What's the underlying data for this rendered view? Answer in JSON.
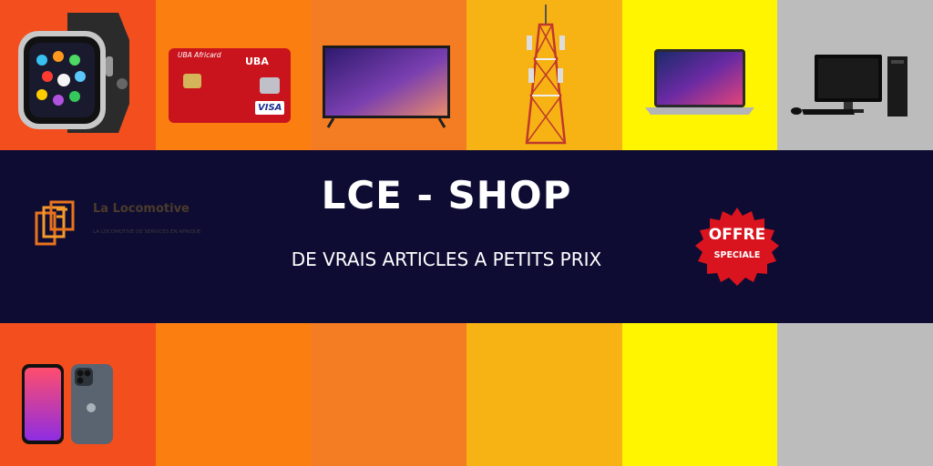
{
  "banner": {
    "title": "LCE - SHOP",
    "subtitle": "DE VRAIS ARTICLES A PETITS PRIX"
  },
  "logo": {
    "name": "La Locomotive",
    "tagline": "LA LOCOMOTIVE DE SERVICES EN AFRIQUE"
  },
  "badge": {
    "line1": "OFFRE",
    "line2": "SPECIALE"
  },
  "products": {
    "card": {
      "brand": "UBA Africard",
      "bank": "UBA",
      "network": "VISA"
    },
    "items": [
      "smartwatch-icon",
      "credit-card-icon",
      "television-icon",
      "telecom-tower-icon",
      "laptop-icon",
      "desktop-computer-icon",
      "smartphone-icon"
    ]
  },
  "colors": {
    "band": "#0f0c33",
    "badge": "#d9141e",
    "stripes": [
      "#f24e1e",
      "#fb7f10",
      "#f47c22",
      "#f7b214",
      "#fff500",
      "#bcbcbc"
    ]
  }
}
